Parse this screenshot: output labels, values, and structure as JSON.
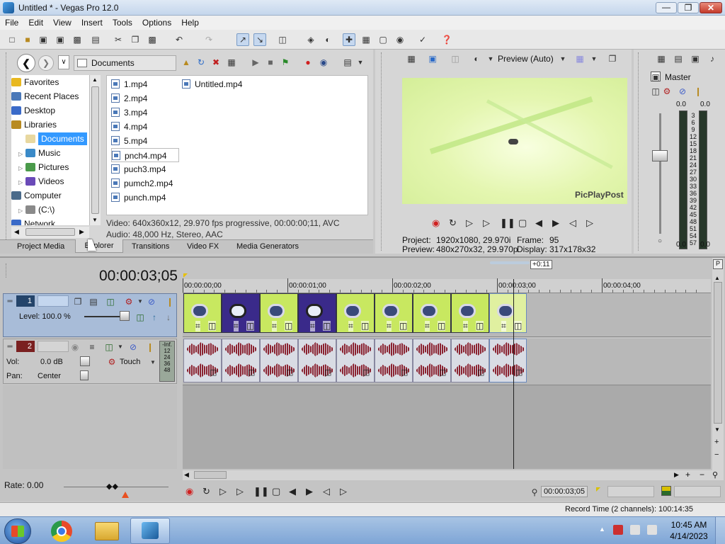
{
  "window": {
    "title": "Untitled * - Vegas Pro 12.0"
  },
  "menu": [
    "File",
    "Edit",
    "View",
    "Insert",
    "Tools",
    "Options",
    "Help"
  ],
  "explorer": {
    "location": "Documents",
    "tree": [
      {
        "label": "Favorites",
        "icon": "star-icon",
        "indent": 0
      },
      {
        "label": "Recent Places",
        "icon": "recent-places-icon",
        "indent": 0
      },
      {
        "label": "Desktop",
        "icon": "desktop-icon",
        "indent": 0
      },
      {
        "label": "Libraries",
        "icon": "library-icon",
        "indent": 0
      },
      {
        "label": "Documents",
        "icon": "documents-icon",
        "indent": 1,
        "selected": true
      },
      {
        "label": "Music",
        "icon": "music-icon",
        "indent": 1
      },
      {
        "label": "Pictures",
        "icon": "pictures-icon",
        "indent": 1
      },
      {
        "label": "Videos",
        "icon": "videos-icon",
        "indent": 1
      },
      {
        "label": "Computer",
        "icon": "computer-icon",
        "indent": 0
      },
      {
        "label": "(C:\\)",
        "icon": "drive-icon",
        "indent": 1
      },
      {
        "label": "Network",
        "icon": "network-icon",
        "indent": 0
      }
    ],
    "files_col1": [
      "1.mp4",
      "2.mp4",
      "3.mp4",
      "4.mp4",
      "5.mp4",
      "pnch4.mp4",
      "puch3.mp4",
      "pumch2.mp4",
      "punch.mp4"
    ],
    "files_col2": [
      "Untitled.mp4"
    ],
    "selected_file": "pnch4.mp4",
    "video_info": "Video: 640x360x12, 29.970 fps progressive, 00:00:00;11, AVC",
    "audio_info": "Audio: 48,000 Hz, Stereo, AAC"
  },
  "tabs": [
    "Project Media",
    "Explorer",
    "Transitions",
    "Video FX",
    "Media Generators"
  ],
  "preview": {
    "mode": "Preview (Auto)",
    "watermark": "PicPlayPost",
    "project_label": "Project:",
    "project_value": "1920x1080, 29.970i",
    "preview_label": "Preview:",
    "preview_value": "480x270x32, 29.970p",
    "frame_label": "Frame:",
    "frame_value": "95",
    "display_label": "Display:",
    "display_value": "317x178x32"
  },
  "master": {
    "title": "Master",
    "left_peak": "0.0",
    "right_peak": "0.0",
    "left_bottom": "0.0",
    "right_bottom": "0.0",
    "scale": [
      "3",
      "6",
      "9",
      "12",
      "15",
      "18",
      "21",
      "24",
      "27",
      "30",
      "33",
      "36",
      "39",
      "42",
      "45",
      "48",
      "51",
      "54",
      "57"
    ]
  },
  "timeline": {
    "timecode": "00:00:03;05",
    "ruler": [
      "00:00:00;00",
      "00:00:01;00",
      "00:00:02;00",
      "00:00:03;00",
      "00:00:04;00"
    ],
    "region_label": "+0:11",
    "video_track": {
      "number": "1",
      "level_label": "Level: 100.0 %",
      "level_pct": 100
    },
    "audio_track": {
      "number": "2",
      "vol_label": "Vol:",
      "vol_value": "0.0 dB",
      "pan_label": "Pan:",
      "pan_value": "Center",
      "automation": "Touch",
      "meter_top": "-Inf.",
      "meter_marks": [
        "12",
        "24",
        "36",
        "48"
      ]
    },
    "rate": "Rate: 0.00",
    "cursor_time": "00:00:03;05",
    "record_time": "Record Time (2 channels): 100:14:35",
    "cursor_position_fraction": 0.795
  },
  "taskbar": {
    "time": "10:45 AM",
    "date": "4/14/2023"
  },
  "colors": {
    "accent": "#3399ff",
    "audio_wave": "#8a2230",
    "preview_bg": "#e8f8b8",
    "clip_green": "#c8e860",
    "clip_blue": "#3a2a8a"
  }
}
